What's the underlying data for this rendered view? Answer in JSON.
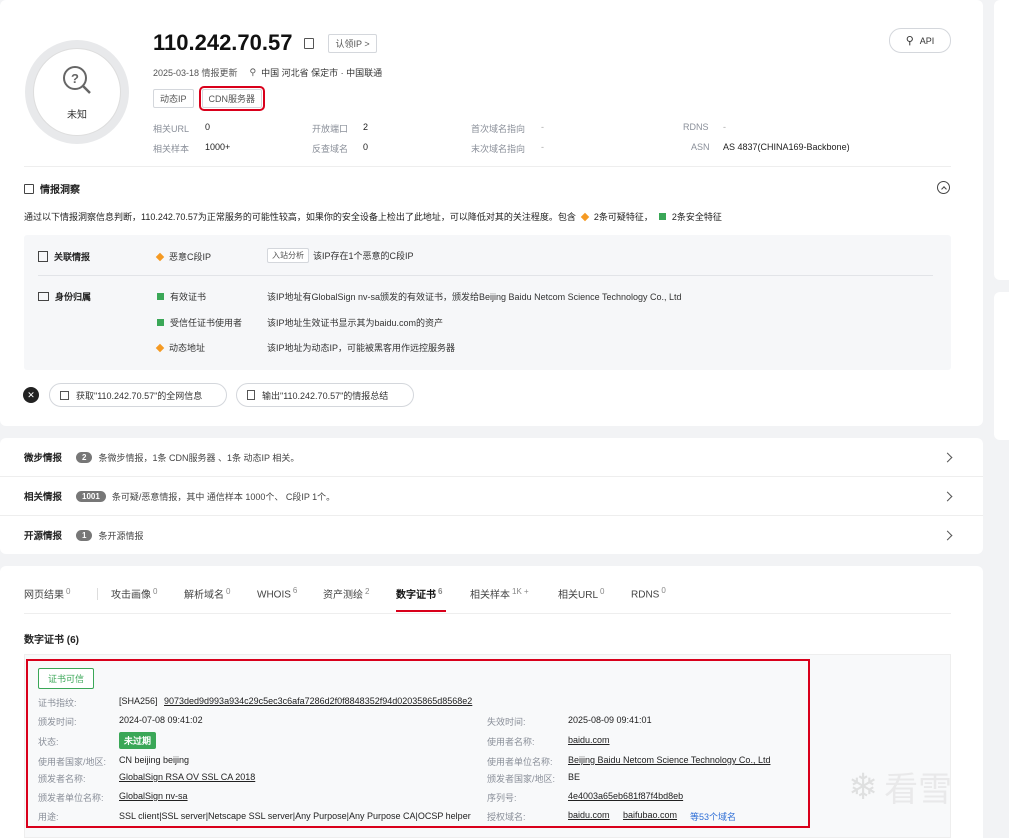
{
  "header": {
    "ip": "110.242.70.57",
    "claim_ip": "认领IP >",
    "api": "API",
    "updated": "2025-03-18 情报更新",
    "location": "中国 河北省 保定市 · 中国联通",
    "verdict": "未知",
    "tags": [
      "动态IP",
      "CDN服务器"
    ],
    "stats": [
      {
        "label": "相关URL",
        "value": "0"
      },
      {
        "label": "开放端口",
        "value": "2"
      },
      {
        "label": "首次域名指向",
        "value": "-"
      },
      {
        "label": "RDNS",
        "value": "-"
      },
      {
        "label": "相关样本",
        "value": "1000+"
      },
      {
        "label": "反查域名",
        "value": "0"
      },
      {
        "label": "末次域名指向",
        "value": "-"
      },
      {
        "label": "ASN",
        "value": "AS 4837(CHINA169-Backbone)"
      }
    ]
  },
  "insight": {
    "title": "情报洞察",
    "desc_prefix": "通过以下情报洞察信息判断，110.242.70.57为正常服务的可能性较高，如果你的安全设备上检出了此地址，可以降低对其的关注程度。包含",
    "suspicious": "2条可疑特征",
    "safe": "2条安全特征",
    "sections": {
      "related": {
        "title": "关联情报",
        "item": "恶意C段IP",
        "tag": "入站分析",
        "text": "该IP存在1个恶意的C段IP"
      },
      "identity": {
        "title": "身份归属",
        "items": [
          {
            "name": "有效证书",
            "text": "该IP地址有GlobalSign nv-sa颁发的有效证书，颁发给Beijing Baidu Netcom Science Technology Co., Ltd"
          },
          {
            "name": "受信任证书使用者",
            "text": "该IP地址生效证书显示其为baidu.com的资产"
          },
          {
            "name": "动态地址",
            "text": "该IP地址为动态IP，可能被黑客用作远控服务器"
          }
        ]
      }
    },
    "btn_fetch": "获取\"110.242.70.57\"的全网信息",
    "btn_export": "输出\"110.242.70.57\"的情报总结"
  },
  "summaries": [
    {
      "title": "微步情报",
      "count": "2",
      "text": "条微步情报，1条 CDN服务器 、1条 动态IP 相关。"
    },
    {
      "title": "相关情报",
      "count": "1001",
      "text": "条可疑/恶意情报，其中 通信样本 1000个、 C段IP 1个。"
    },
    {
      "title": "开源情报",
      "count": "1",
      "text": "条开源情报"
    }
  ],
  "tabs": [
    {
      "label": "网页结果",
      "count": "0"
    },
    {
      "label": "攻击画像",
      "count": "0"
    },
    {
      "label": "解析域名",
      "count": "0"
    },
    {
      "label": "WHOIS",
      "count": "6"
    },
    {
      "label": "资产测绘",
      "count": "2"
    },
    {
      "label": "数字证书",
      "count": "6"
    },
    {
      "label": "相关样本",
      "count": "1K +"
    },
    {
      "label": "相关URL",
      "count": "0"
    },
    {
      "label": "RDNS",
      "count": "0"
    }
  ],
  "cert": {
    "section_title": "数字证书 (6)",
    "trusted": "证书可信",
    "fp_label": "证书指纹:",
    "fp_prefix": "[SHA256]",
    "fp_value": "9073ded9d993a934c29c5ec3c6afa7286d2f0f8848352f94d02035865d8568e2",
    "issued_label": "颁发时间:",
    "issued": "2024-07-08 09:41:02",
    "expire_label": "失效时间:",
    "expire": "2025-08-09 09:41:01",
    "status_label": "状态:",
    "status": "未过期",
    "subject_name_label": "使用者名称:",
    "subject_name": "baidu.com",
    "subject_country_label": "使用者国家/地区:",
    "subject_country": "CN beijing beijing",
    "subject_org_label": "使用者单位名称:",
    "subject_org": "Beijing Baidu Netcom Science Technology Co., Ltd",
    "issuer_name_label": "颁发者名称:",
    "issuer_name": "GlobalSign RSA OV SSL CA 2018",
    "issuer_country_label": "颁发者国家/地区:",
    "issuer_country": "BE",
    "issuer_org_label": "颁发者单位名称:",
    "issuer_org": "GlobalSign nv-sa",
    "serial_label": "序列号:",
    "serial": "4e4003a65eb681f87f4bd8eb",
    "usage_label": "用途:",
    "usage": "SSL client|SSL server|Netscape SSL server|Any Purpose|Any Purpose CA|OCSP helper",
    "san_label": "授权域名:",
    "san1": "baidu.com",
    "san2": "baifubao.com",
    "san_more": "等53个域名"
  },
  "watermark": "看雪",
  "colors": {
    "accent_red": "#d9001b",
    "green": "#3aa757",
    "orange": "#f59a23",
    "link_blue": "#2f6fd6"
  }
}
